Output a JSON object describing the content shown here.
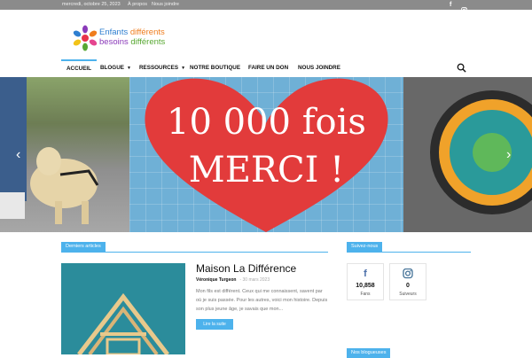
{
  "topbar": {
    "date": "mercredi, octobre 25, 2023",
    "links": [
      "À propos",
      "Nous joindre"
    ],
    "icons": [
      "facebook-icon",
      "instagram-icon"
    ]
  },
  "logo": {
    "line1": [
      "Enfants ",
      "différents"
    ],
    "line2": [
      "besoins ",
      "différents"
    ]
  },
  "nav": {
    "items": [
      "ACCUEIL",
      "BLOGUE",
      "RESSOURCES",
      "NOTRE BOUTIQUE",
      "FAIRE UN DON",
      "NOUS JOINDRE"
    ],
    "accent": "#4db2ec"
  },
  "hero": {
    "line1": "10 000 fois",
    "line2": "MERCI !"
  },
  "latest": {
    "label": "Derniers articles",
    "article": {
      "title": "Maison La Différence",
      "author": "Véronique Turgeon",
      "date": "- 30 mars 2023",
      "excerpt": "Mon fils est différent. Ceux qui me connaissent, savent par où je suis passée. Pour les autres, voici mon histoire. Depuis son plus jeune âge, je savais que mon...",
      "button": "Lire la suite"
    }
  },
  "follow": {
    "label": "Suivez-nous",
    "facebook": {
      "count": "10,858",
      "label": "Fans"
    },
    "instagram": {
      "count": "0",
      "label": "Suiveurs"
    }
  },
  "bloggers": {
    "label": "Nos blogueuses"
  }
}
